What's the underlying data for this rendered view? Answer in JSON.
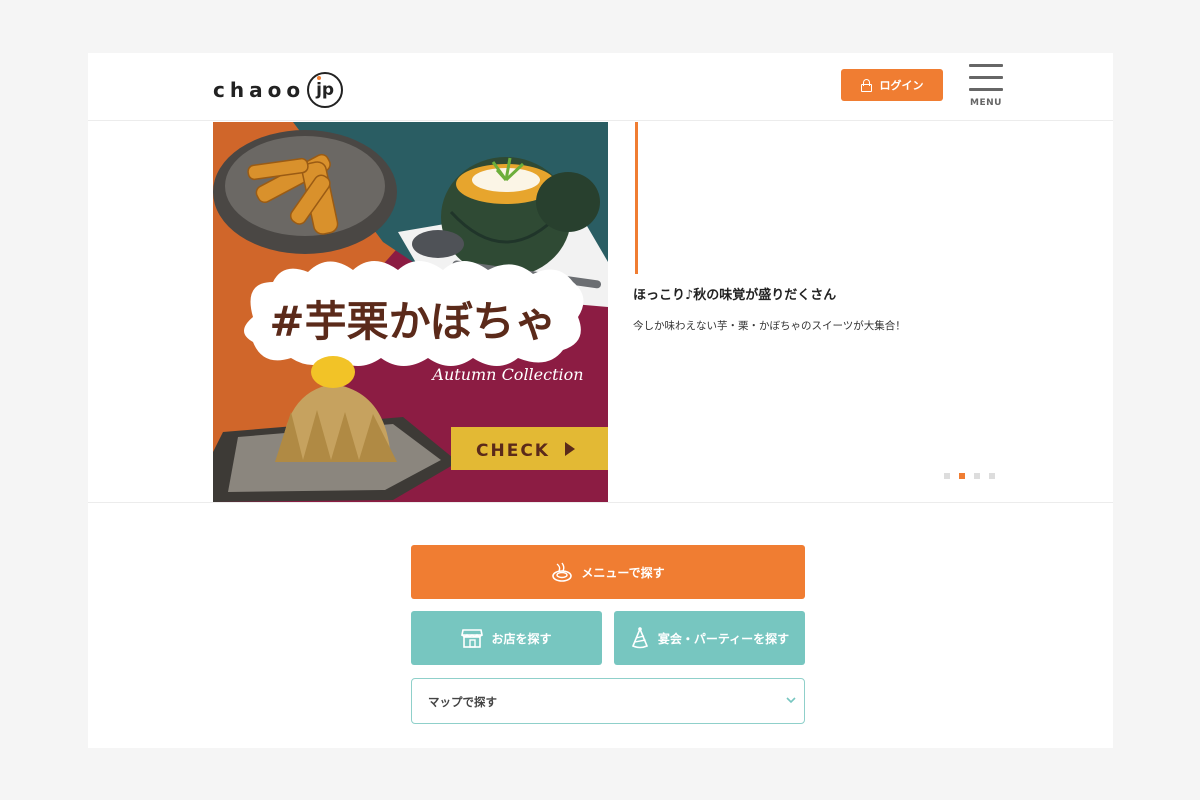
{
  "header": {
    "logo_text": "chaoo",
    "logo_domain": "jp",
    "login_label": "ログイン",
    "menu_label": "MENU"
  },
  "banner": {
    "hashtag": "#芋栗かぼちゃ",
    "collection": "Autumn Collection",
    "cta": "CHECK"
  },
  "hero": {
    "title": "ほっこり♪秋の味覚が盛りだくさん",
    "description": "今しか味わえない芋・栗・かぼちゃのスイーツが大集合！",
    "slides_total": 4,
    "active_slide": 2
  },
  "search": {
    "menu_button": "メニューで探す",
    "shop_button": "お店を探す",
    "party_button": "宴会・パーティーを探す",
    "map_select": "マップで探す"
  },
  "colors": {
    "accent": "#f07d32",
    "teal": "#77c6c0",
    "banner_crimson": "#8c1c43",
    "banner_teal": "#2a5d63",
    "banner_orange": "#d0662a",
    "banner_yellow": "#e3b934"
  }
}
